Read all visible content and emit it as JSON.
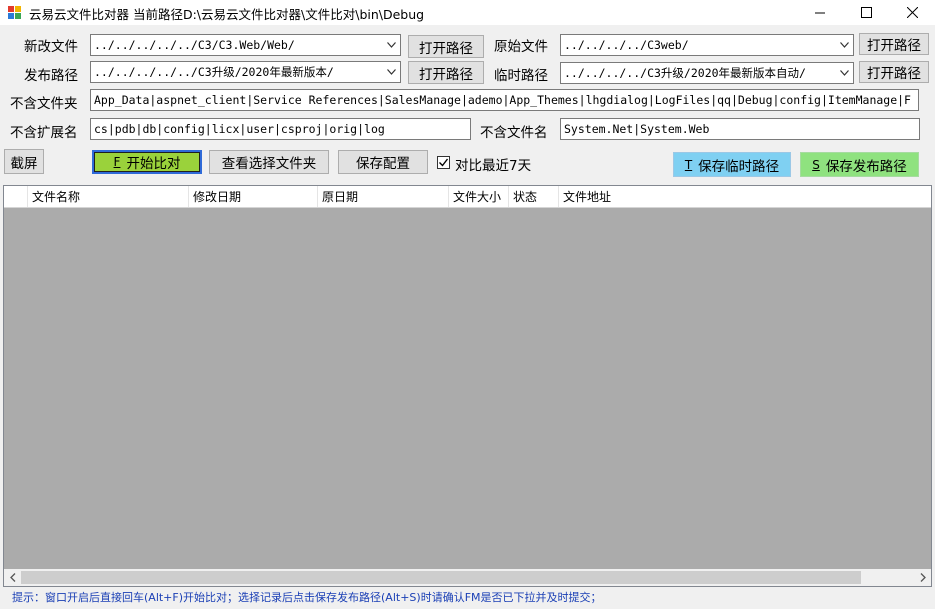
{
  "window": {
    "title": "云易云文件比对器 当前路径D:\\云易云文件比对器\\文件比对\\bin\\Debug",
    "minimize_label": "minimize",
    "maximize_label": "maximize",
    "close_label": "close"
  },
  "form": {
    "new_file_label": "新改文件",
    "new_file_value": "../../../../../C3/C3.Web/Web/",
    "new_file_open": "打开路径",
    "orig_file_label": "原始文件",
    "orig_file_value": "../../../../C3web/",
    "orig_file_open": "打开路径",
    "publish_label": "发布路径",
    "publish_value": "../../../../../C3升级/2020年最新版本/",
    "publish_open": "打开路径",
    "temp_label": "临时路径",
    "temp_value": "../../../../C3升级/2020年最新版本自动/",
    "temp_open": "打开路径",
    "excl_folder_label": "不含文件夹",
    "excl_folder_value": "App_Data|aspnet_client|Service References|SalesManage|ademo|App_Themes|lhgdialog|LogFiles|qq|Debug|config|ItemManage|F",
    "excl_ext_label": "不含扩展名",
    "excl_ext_value": "cs|pdb|db|config|licx|user|csproj|orig|log",
    "excl_file_label": "不含文件名",
    "excl_file_value": "System.Net|System.Web"
  },
  "toolbar": {
    "screenshot": "截屏",
    "start_key": "F",
    "start_label": "开始比对",
    "view_folder": "查看选择文件夹",
    "save_config": "保存配置",
    "recent_label": "对比最近7天",
    "recent_checked": true,
    "save_temp_key": "T",
    "save_temp_label": "保存临时路径",
    "save_pub_key": "S",
    "save_pub_label": "保存发布路径"
  },
  "grid": {
    "columns": [
      "文件名称",
      "修改日期",
      "原日期",
      "文件大小",
      "状态",
      "文件地址"
    ]
  },
  "status": {
    "hint": "提示：窗口开启后直接回车(Alt+F)开始比对；选择记录后点击保存发布路径(Alt+S)时请确认FM是否已下拉并及时提交；"
  },
  "colors": {
    "start_button": "#9ad23b",
    "save_temp_button": "#7fd0f2",
    "save_pub_button": "#8fe27f",
    "grid_background": "#ababab",
    "status_text": "#1a3fb5"
  }
}
